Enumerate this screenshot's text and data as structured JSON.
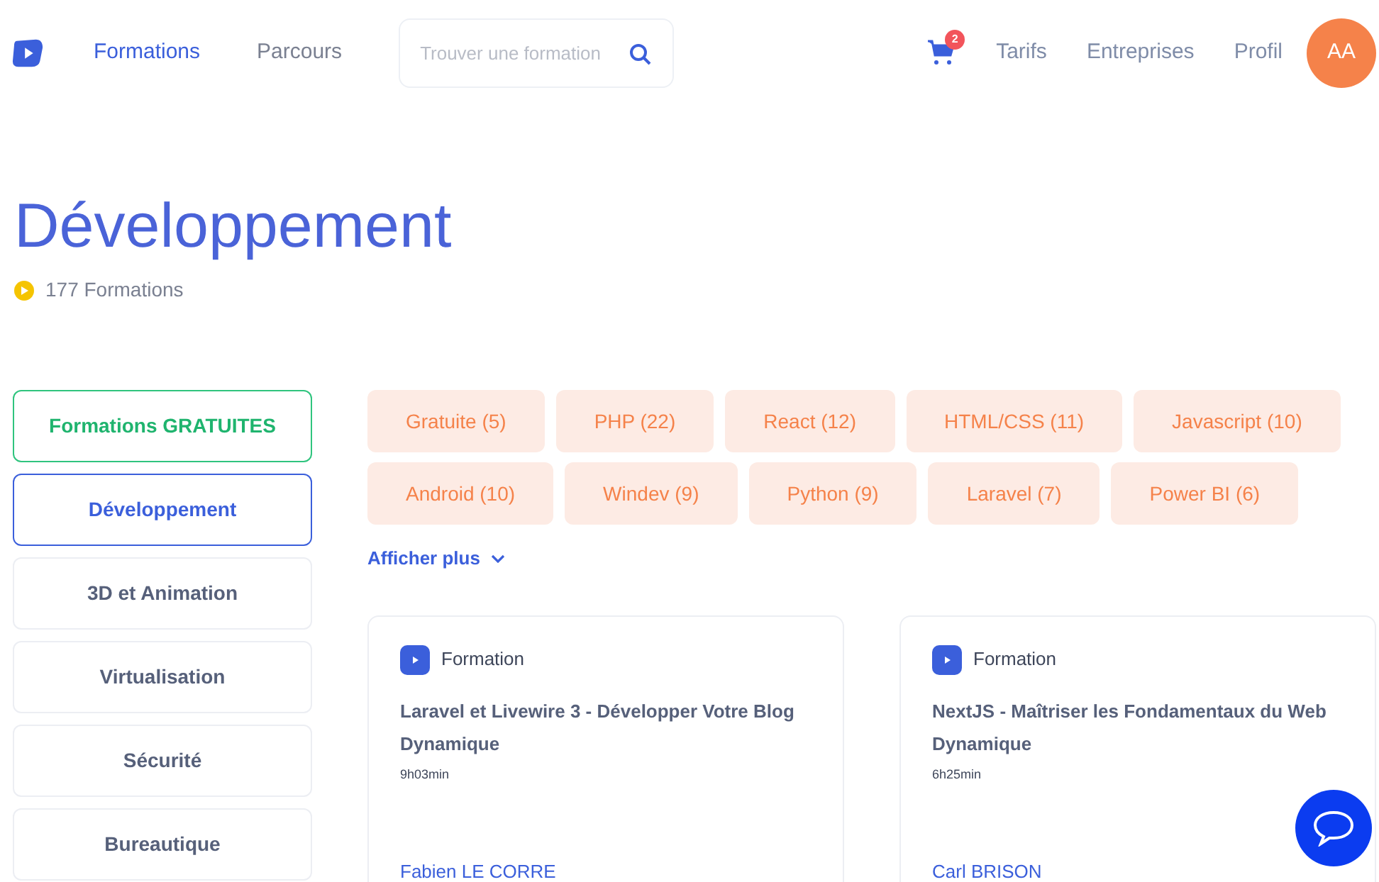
{
  "nav": {
    "links": [
      {
        "label": "Formations",
        "selected": true
      },
      {
        "label": "Parcours",
        "selected": false
      }
    ],
    "search": {
      "placeholder": "Trouver une formation"
    },
    "cart_badge": "2",
    "right_links": [
      {
        "label": "Tarifs"
      },
      {
        "label": "Entreprises"
      },
      {
        "label": "Profil"
      }
    ],
    "avatar": "AA"
  },
  "heading": {
    "title": "Développement",
    "count": "177 Formations"
  },
  "sidebar": {
    "items": [
      {
        "label": "Formations GRATUITES",
        "kind": "free",
        "selected": false
      },
      {
        "label": "Développement",
        "kind": "category",
        "selected": true
      },
      {
        "label": "3D et Animation",
        "kind": "category",
        "selected": false
      },
      {
        "label": "Virtualisation",
        "kind": "category",
        "selected": false
      },
      {
        "label": "Sécurité",
        "kind": "category",
        "selected": false
      },
      {
        "label": "Bureautique",
        "kind": "category",
        "selected": false
      }
    ]
  },
  "tags": [
    [
      "Gratuite (5)",
      "PHP (22)",
      "React (12)",
      "HTML/CSS (11)",
      "Javascript (10)"
    ],
    [
      "Android (10)",
      "Windev (9)",
      "Python (9)",
      "Laravel (7)",
      "Power BI (6)"
    ]
  ],
  "show_more": "Afficher plus",
  "cards": [
    {
      "type": "Formation",
      "title": "Laravel et Livewire 3 - Développer Votre Blog Dynamique",
      "duration": "9h03min",
      "author": "Fabien LE CORRE"
    },
    {
      "type": "Formation",
      "title": "NextJS - Maîtriser les Fondamentaux du Web Dynamique",
      "duration": "6h25min",
      "author": "Carl BRISON"
    }
  ]
}
